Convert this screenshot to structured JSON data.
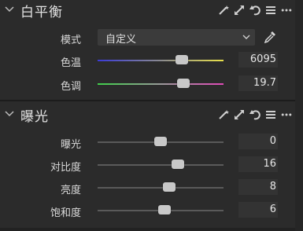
{
  "white_balance": {
    "title": "白平衡",
    "mode_label": "模式",
    "mode_value": "自定义",
    "sliders": [
      {
        "label": "色温",
        "value": "6095",
        "level": 0.67
      },
      {
        "label": "色调",
        "value": "19.7",
        "level": 0.68
      }
    ]
  },
  "exposure": {
    "title": "曝光",
    "sliders": [
      {
        "label": "曝光",
        "value": "0",
        "level": 0.5
      },
      {
        "label": "对比度",
        "value": "16",
        "level": 0.64
      },
      {
        "label": "亮度",
        "value": "8",
        "level": 0.57
      },
      {
        "label": "饱和度",
        "value": "6",
        "level": 0.53
      }
    ]
  },
  "colors": {
    "panel_bg": "#2b2b2b",
    "temperature_gradient": [
      "#3b3bd8",
      "#e8e04a"
    ],
    "tint_gradient": [
      "#3fcf4a",
      "#e04ab8"
    ],
    "neutral_track": "#5a5a5a"
  },
  "icons": {
    "header_tools": [
      "wand-icon",
      "expand-icon",
      "reset-icon",
      "list-icon",
      "more-icon"
    ],
    "eyedropper": "eyedropper-icon",
    "collapse": "chevron-down-icon"
  }
}
